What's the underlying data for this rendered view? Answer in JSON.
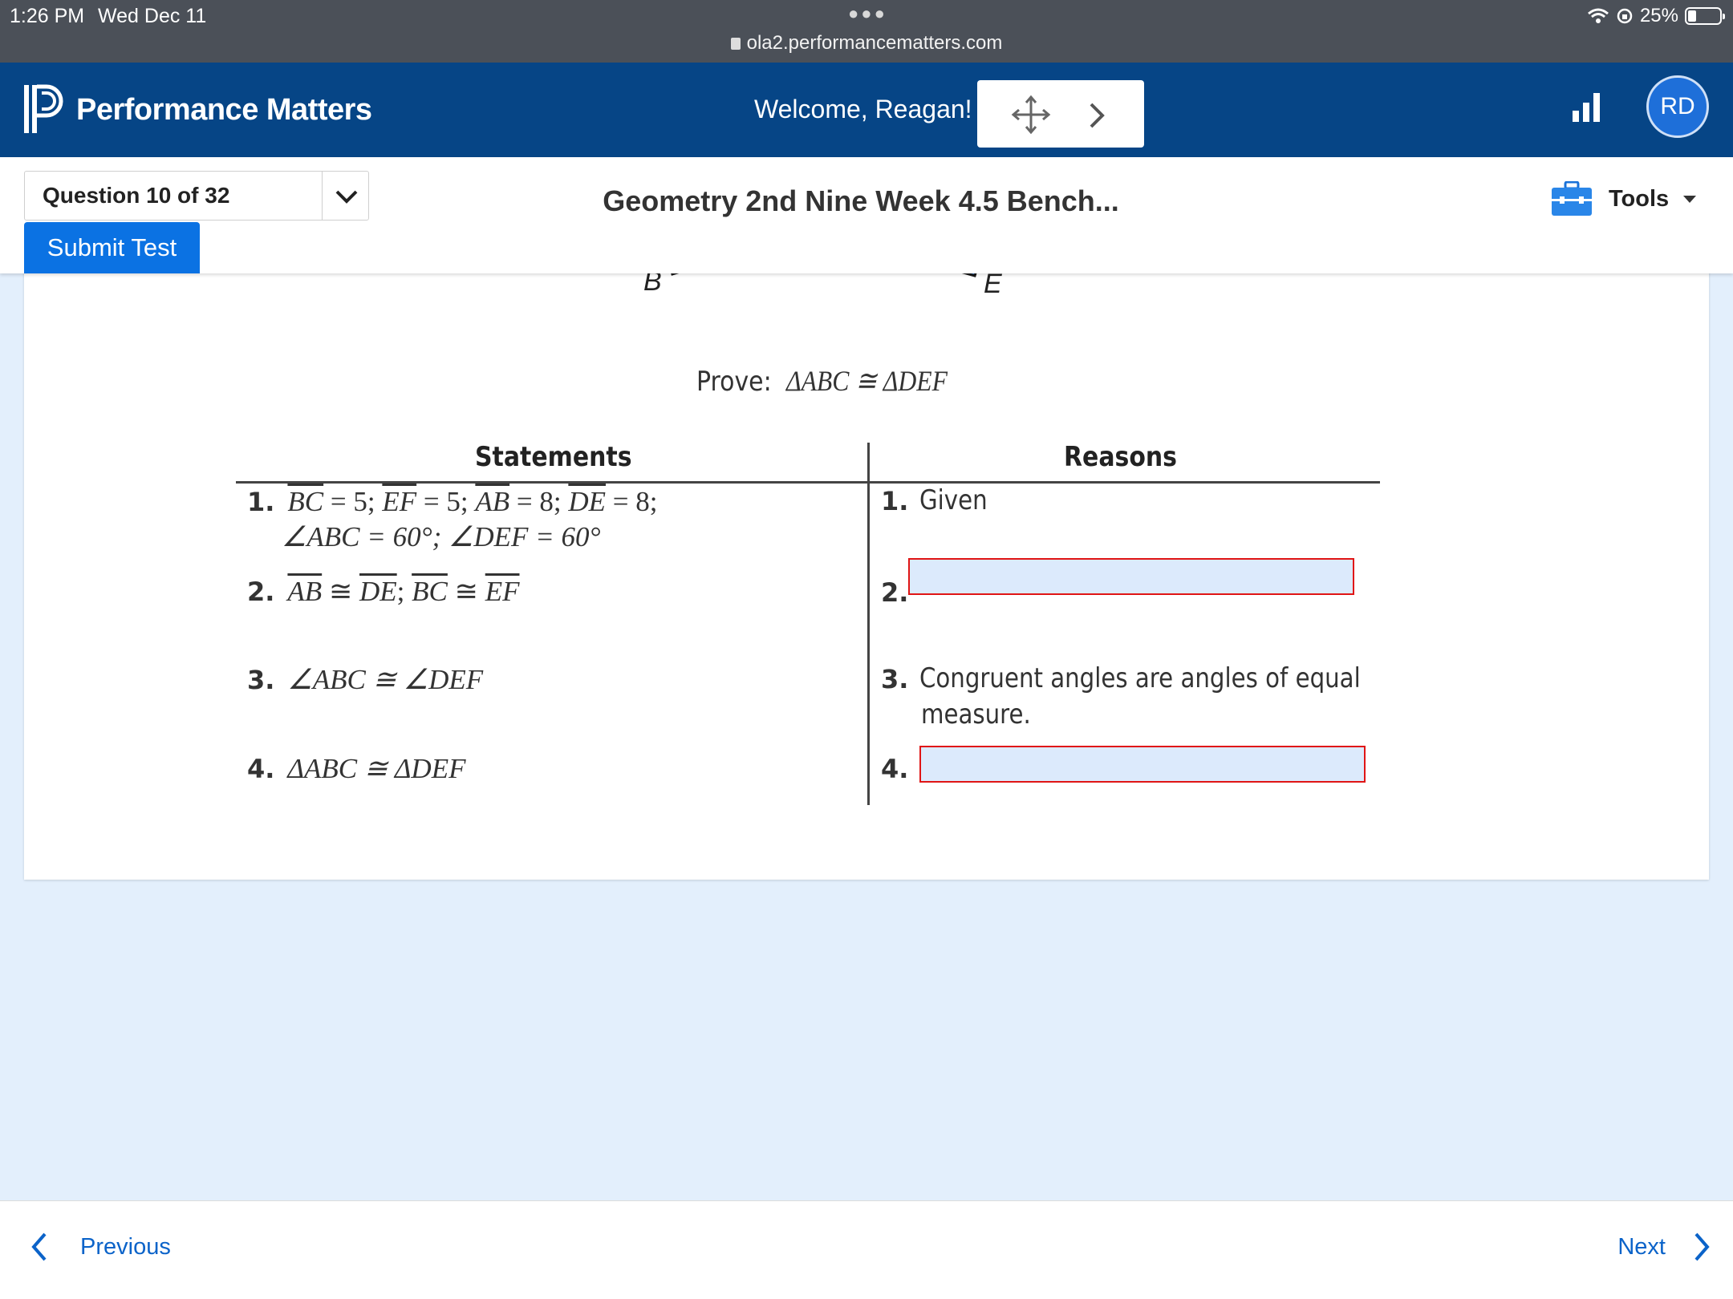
{
  "status_bar": {
    "time": "1:26 PM",
    "date": "Wed Dec 11",
    "url": "ola2.performancematters.com",
    "battery": "25%",
    "battery_level_percent": 25
  },
  "header": {
    "brand": "Performance Matters",
    "welcome": "Welcome, Reagan!",
    "avatar_initials": "RD",
    "brand_color": "#064586"
  },
  "toolbar": {
    "question_selector": "Question 10 of 32",
    "submit_label": "Submit Test",
    "test_title": "Geometry 2nd Nine Week 4.5 Bench...",
    "tools_label": "Tools"
  },
  "question": {
    "figure_labels": {
      "b": "B",
      "e": "E"
    },
    "prove_label": "Prove:",
    "prove_statement": "ΔABC ≅ ΔDEF",
    "statements_header": "Statements",
    "reasons_header": "Reasons",
    "statements": [
      {
        "num": "1.",
        "line1_parts": [
          "BC",
          " = 5;  ",
          "EF",
          " = 5; ",
          "AB",
          " = 8;  ",
          "DE",
          " = 8;"
        ],
        "line2": "∠ABC = 60°; ∠DEF = 60°"
      },
      {
        "num": "2.",
        "parts": [
          "AB",
          " ≅ ",
          "DE",
          "; ",
          "BC",
          " ≅ ",
          "EF"
        ]
      },
      {
        "num": "3.",
        "text": "∠ABC  ≅ ∠DEF"
      },
      {
        "num": "4.",
        "text": "ΔABC ≅ ΔDEF"
      }
    ],
    "reasons": [
      {
        "num": "1.",
        "text": "Given"
      },
      {
        "num": "2.",
        "answer": ""
      },
      {
        "num": "3.",
        "line1": "Congruent angles are angles of equal",
        "line2": "measure."
      },
      {
        "num": "4.",
        "answer": ""
      }
    ]
  },
  "footer": {
    "previous_label": "Previous",
    "next_label": "Next",
    "link_color": "#0b63c9"
  }
}
